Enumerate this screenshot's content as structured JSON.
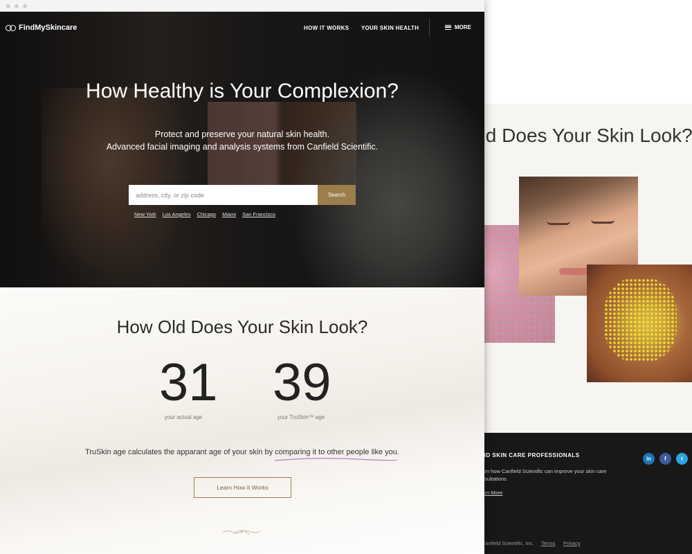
{
  "back_page": {
    "heading": "How Old Does Your Skin Look?",
    "footer": {
      "title": "FIND SKIN CARE PROFESSIONALS",
      "text": "Learn how Canfield Scientific can improve your skin care consultations.",
      "learn_more": "Learn More",
      "copyright": "© Canfield Scientific, Inc.",
      "terms": "Terms",
      "privacy": "Privacy",
      "social": [
        "in",
        "f",
        "t"
      ]
    }
  },
  "nav": {
    "logo": "FindMySkincare",
    "links": [
      "HOW IT WORKS",
      "YOUR SKIN HEALTH"
    ],
    "more": "MORE"
  },
  "hero": {
    "title": "How Healthy is Your Complexion?",
    "subtitle_line1": "Protect and preserve your natural skin health.",
    "subtitle_line2": "Advanced facial imaging and analysis systems from Canfield Scientific.",
    "search_placeholder": "address, city, or zip code",
    "search_button": "Search",
    "cities": [
      "New York",
      "Los Angeles",
      "Chicago",
      "Miami",
      "San Francisco"
    ]
  },
  "age_section": {
    "title": "How Old Does Your Skin Look?",
    "actual_age": "31",
    "actual_label": "your actual age",
    "truskin_age": "39",
    "truskin_label": "your TruSkin™ age",
    "description": "TruSkin age calculates the apparant age of your skin by comparing it to other people like you.",
    "button": "Learn How It Works"
  },
  "colors": {
    "accent": "#9c7d4c",
    "hero_dark": "#1f1e1d",
    "linkedin": "#1a76b6",
    "facebook": "#3b5a9a",
    "twitter": "#2ba4df"
  }
}
